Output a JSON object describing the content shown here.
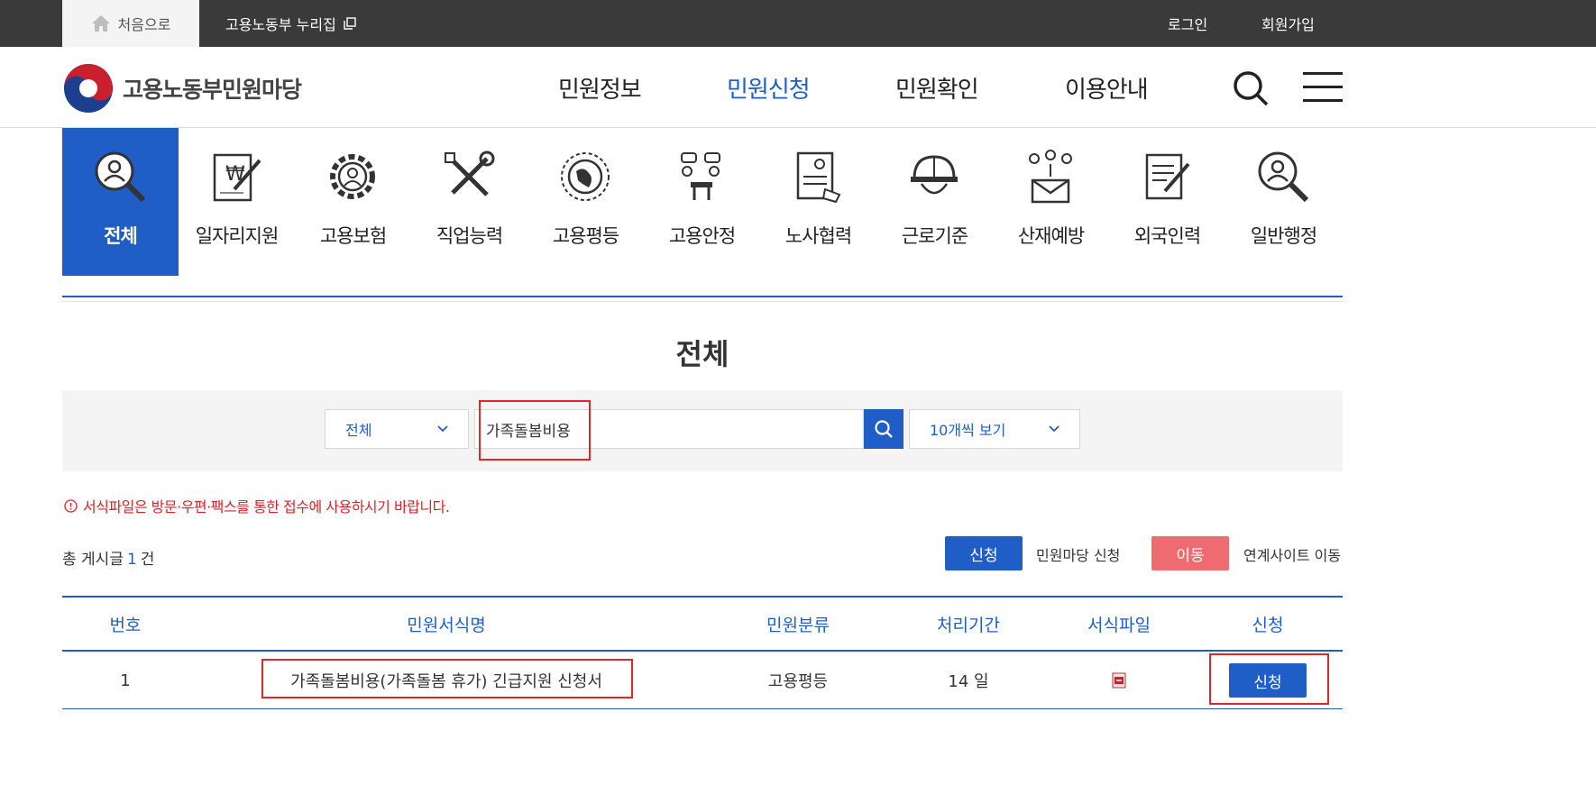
{
  "topbar": {
    "home_label": "처음으로",
    "nurijip_label": "고용노동부 누리집",
    "login_label": "로그인",
    "signup_label": "회원가입"
  },
  "header": {
    "logo_text": "고용노동부민원마당",
    "nav": [
      {
        "label": "민원정보",
        "active": false
      },
      {
        "label": "민원신청",
        "active": true
      },
      {
        "label": "민원확인",
        "active": false
      },
      {
        "label": "이용안내",
        "active": false
      }
    ]
  },
  "categories": [
    {
      "label": "전체",
      "icon": "search-person-icon",
      "active": true
    },
    {
      "label": "일자리지원",
      "icon": "won-document-icon",
      "active": false
    },
    {
      "label": "고용보험",
      "icon": "gear-person-icon",
      "active": false
    },
    {
      "label": "직업능력",
      "icon": "tools-icon",
      "active": false
    },
    {
      "label": "고용평등",
      "icon": "globe-icon",
      "active": false
    },
    {
      "label": "고용안정",
      "icon": "meeting-icon",
      "active": false
    },
    {
      "label": "노사협력",
      "icon": "document-hand-icon",
      "active": false
    },
    {
      "label": "근로기준",
      "icon": "helmet-icon",
      "active": false
    },
    {
      "label": "산재예방",
      "icon": "people-mail-icon",
      "active": false
    },
    {
      "label": "외국인력",
      "icon": "document-pen-icon",
      "active": false
    },
    {
      "label": "일반행정",
      "icon": "search-person-icon",
      "active": false
    }
  ],
  "page_title": "전체",
  "search": {
    "scope_selected": "전체",
    "query": "가족돌봄비용",
    "page_size_selected": "10개씩 보기"
  },
  "notice": "서식파일은 방문·우편·팩스를 통한 접수에 사용하시기 바랍니다.",
  "count": {
    "prefix": "총 게시글",
    "value": "1",
    "suffix": "건"
  },
  "legend": {
    "apply_btn": "신청",
    "apply_desc": "민원마당 신청",
    "move_btn": "이동",
    "move_desc": "연계사이트 이동"
  },
  "table": {
    "headers": [
      "번호",
      "민원서식명",
      "민원분류",
      "처리기간",
      "서식파일",
      "신청"
    ],
    "rows": [
      {
        "no": "1",
        "name": "가족돌봄비용(가족돌봄 휴가) 긴급지원 신청서",
        "category": "고용평등",
        "period": "14 일",
        "file_icon": "hwp-file-icon",
        "action": "신청"
      }
    ]
  },
  "colors": {
    "primary": "#1f5ec7",
    "topbar": "#3a3a3a",
    "move": "#ee6b70",
    "alert": "#d8232a"
  }
}
